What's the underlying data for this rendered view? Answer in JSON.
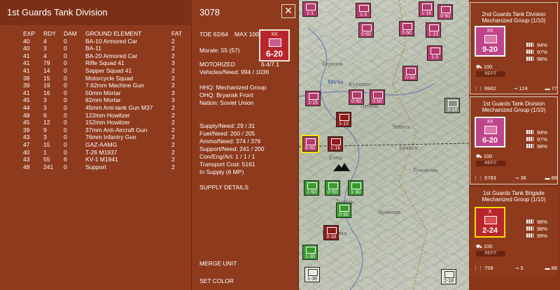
{
  "panel": {
    "title": "1st Guards Tank Division",
    "unit_id": "3078",
    "close_label": "✕",
    "table": {
      "headers": [
        "EXP",
        "RDY",
        "DAM",
        "GROUND ELEMENT",
        "FAT"
      ],
      "rows": [
        [
          "40",
          "4",
          "0",
          "BA-10 Armored Car",
          "2"
        ],
        [
          "40",
          "3",
          "0",
          "BA-11",
          "2"
        ],
        [
          "41",
          "4",
          "0",
          "BA-20 Armored Car",
          "2"
        ],
        [
          "41",
          "79",
          "0",
          "Rifle Squad 41",
          "3"
        ],
        [
          "41",
          "14",
          "0",
          "Sapper Squad 41",
          "2"
        ],
        [
          "38",
          "15",
          "0",
          "Motorcycle Squad",
          "2"
        ],
        [
          "39",
          "19",
          "0",
          "7.62mm Machine Gun",
          "2"
        ],
        [
          "41",
          "16",
          "0",
          "50mm Mortar",
          "3"
        ],
        [
          "45",
          "3",
          "0",
          "82mm Mortar",
          "3"
        ],
        [
          "44",
          "3",
          "0",
          "45mm Anti-tank Gun M37",
          "2"
        ],
        [
          "48",
          "6",
          "0",
          "122mm Howitzer",
          "2"
        ],
        [
          "45",
          "12",
          "0",
          "152mm Howitzer",
          "2"
        ],
        [
          "39",
          "9",
          "0",
          "37mm Anti-Aircraft Gun",
          "2"
        ],
        [
          "43",
          "3",
          "0",
          "76mm Infantry Gun",
          "2"
        ],
        [
          "47",
          "15",
          "0",
          "GAZ-AAMG",
          "2"
        ],
        [
          "40",
          "1",
          "0",
          "T-26 M1937",
          "2"
        ],
        [
          "43",
          "55",
          "6",
          "KV-1 M1941",
          "2"
        ],
        [
          "48",
          "241",
          "0",
          "Support",
          "2"
        ]
      ]
    },
    "info": {
      "toe": "TOE 62/64",
      "max": "MAX 100",
      "morale": "Morale:   55 (57)",
      "motorized": "MOTORIZED",
      "motorized_val": "6.4/7.1",
      "vehicles": "Vehicles/Need:   994 / 1036",
      "hhq": "HHQ:  Mechanized Group",
      "ohq": "OHQ:  Bryansk Front",
      "nation": "Nation:   Soviet Union",
      "supply": "Supply/Need:   29 / 31",
      "fuel": "Fuel/Need:     200 / 205",
      "ammo": "Ammo/Need:   374 / 376",
      "support": "Support/Need:   241 / 200",
      "cor": "Con/Eng/Art:  1 / 1 / 1",
      "transport": "Transport Cost:      5161",
      "insupply": "In Supply  (6 MP)"
    },
    "counter": {
      "size": "XX",
      "strength": "6-20"
    },
    "actions": {
      "supply_details": "SUPPLY DETAILS",
      "merge_unit": "MERGE UNIT",
      "set_color": "SET COLOR"
    }
  },
  "stack": [
    {
      "title": "2nd Guards Tank Division",
      "subtitle": "Mechanized Group (1/10)",
      "size": "XX",
      "strength": "9-20",
      "move": "100",
      "pcts": [
        "94%",
        "97%",
        "98%"
      ],
      "refit": "REFIT",
      "men": "9962",
      "guns": "124",
      "tanks": "77",
      "color": "#c0448a"
    },
    {
      "title": "1st Guards Tank Division",
      "subtitle": "Mechanized Group (1/10)",
      "size": "XX",
      "strength": "6-20",
      "move": "100",
      "pcts": [
        "94%",
        "97%",
        "98%"
      ],
      "refit": "REFIT",
      "men": "6783",
      "guns": "36",
      "tanks": "88",
      "color": "#c0448a"
    },
    {
      "title": "1st Guards Tank Brigade",
      "subtitle": "Mechanized Group (1/10)",
      "size": "X",
      "strength": "2-24",
      "move": "100",
      "pcts": [
        "98%",
        "98%",
        "99%"
      ],
      "refit": "REFIT",
      "men": "758",
      "guns": "5",
      "tanks": "88",
      "color": "#b8262b"
    }
  ],
  "map": {
    "labels": [
      "Березов",
      "Куркино",
      "Лебедь",
      "Елец",
      "Брянск",
      "Чебесь",
      "Туманова",
      "Ярмыши",
      "Ивановка",
      "Тарусь"
    ],
    "river": "Меча",
    "counters": [
      {
        "t": "1-1"
      },
      {
        "t": "1-3"
      },
      {
        "t": "1-16"
      },
      {
        "t": "0-50"
      },
      {
        "t": "0-50"
      },
      {
        "t": "0-50"
      },
      {
        "t": "1-13"
      },
      {
        "t": "0-50"
      },
      {
        "t": "1-3"
      },
      {
        "t": "1-15"
      },
      {
        "t": "0-50"
      },
      {
        "t": "0-50"
      },
      {
        "t": "1-12"
      },
      {
        "t": "6-50"
      },
      {
        "t": "1-16"
      },
      {
        "t": "1-50"
      },
      {
        "t": "0-50"
      },
      {
        "t": "1-30"
      },
      {
        "t": "0-50"
      },
      {
        "t": "1-30"
      },
      {
        "t": "1-36"
      },
      {
        "t": "3-18"
      },
      {
        "t": "2-18"
      },
      {
        "t": "2-14"
      }
    ]
  }
}
